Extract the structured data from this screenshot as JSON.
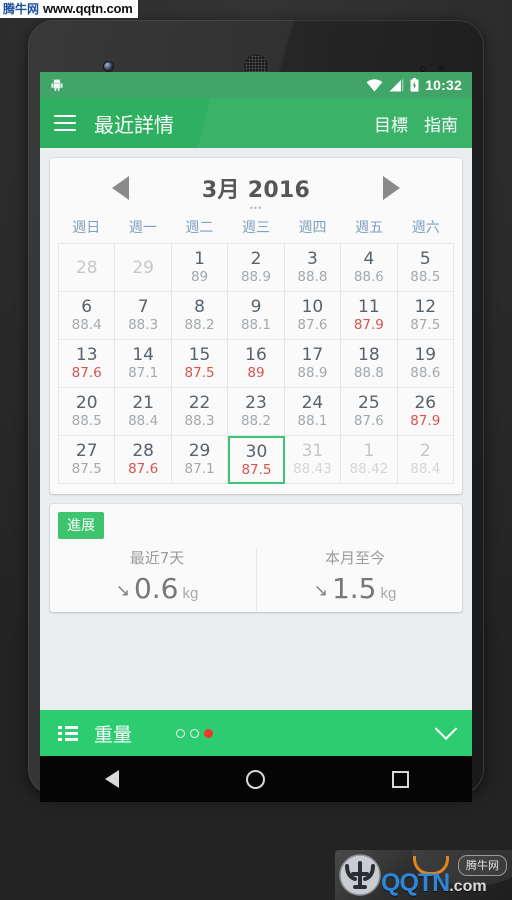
{
  "watermarks": {
    "top_left_cn": "腾牛网",
    "top_left_url": "www.qqtn.com",
    "bottom_right_brand": "QQTN",
    "bottom_right_tld": ".com",
    "bottom_right_badge": "腾牛网"
  },
  "statusbar": {
    "time": "10:32",
    "icons": [
      "android-robot-icon",
      "wifi-icon",
      "signal-icon",
      "battery-charging-icon"
    ]
  },
  "toolbar": {
    "menu_icon": "hamburger-menu-icon",
    "title": "最近詳情",
    "action_goal": "目標",
    "action_guide": "指南"
  },
  "calendar": {
    "prev_icon": "triangle-left-icon",
    "next_icon": "triangle-right-icon",
    "title": "3月 2016",
    "dots": "•••",
    "weekdays": [
      "週日",
      "週一",
      "週二",
      "週三",
      "週四",
      "週五",
      "週六"
    ],
    "rows": [
      [
        {
          "day": "28",
          "value": "",
          "muted": true,
          "red": false,
          "selected": false
        },
        {
          "day": "29",
          "value": "",
          "muted": true,
          "red": false,
          "selected": false
        },
        {
          "day": "1",
          "value": "89",
          "muted": false,
          "red": false,
          "selected": false
        },
        {
          "day": "2",
          "value": "88.9",
          "muted": false,
          "red": false,
          "selected": false
        },
        {
          "day": "3",
          "value": "88.8",
          "muted": false,
          "red": false,
          "selected": false
        },
        {
          "day": "4",
          "value": "88.6",
          "muted": false,
          "red": false,
          "selected": false
        },
        {
          "day": "5",
          "value": "88.5",
          "muted": false,
          "red": false,
          "selected": false
        }
      ],
      [
        {
          "day": "6",
          "value": "88.4",
          "muted": false,
          "red": false,
          "selected": false
        },
        {
          "day": "7",
          "value": "88.3",
          "muted": false,
          "red": false,
          "selected": false
        },
        {
          "day": "8",
          "value": "88.2",
          "muted": false,
          "red": false,
          "selected": false
        },
        {
          "day": "9",
          "value": "88.1",
          "muted": false,
          "red": false,
          "selected": false
        },
        {
          "day": "10",
          "value": "87.6",
          "muted": false,
          "red": false,
          "selected": false
        },
        {
          "day": "11",
          "value": "87.9",
          "muted": false,
          "red": true,
          "selected": false
        },
        {
          "day": "12",
          "value": "87.5",
          "muted": false,
          "red": false,
          "selected": false
        }
      ],
      [
        {
          "day": "13",
          "value": "87.6",
          "muted": false,
          "red": true,
          "selected": false
        },
        {
          "day": "14",
          "value": "87.1",
          "muted": false,
          "red": false,
          "selected": false
        },
        {
          "day": "15",
          "value": "87.5",
          "muted": false,
          "red": true,
          "selected": false
        },
        {
          "day": "16",
          "value": "89",
          "muted": false,
          "red": true,
          "selected": false
        },
        {
          "day": "17",
          "value": "88.9",
          "muted": false,
          "red": false,
          "selected": false
        },
        {
          "day": "18",
          "value": "88.8",
          "muted": false,
          "red": false,
          "selected": false
        },
        {
          "day": "19",
          "value": "88.6",
          "muted": false,
          "red": false,
          "selected": false
        }
      ],
      [
        {
          "day": "20",
          "value": "88.5",
          "muted": false,
          "red": false,
          "selected": false
        },
        {
          "day": "21",
          "value": "88.4",
          "muted": false,
          "red": false,
          "selected": false
        },
        {
          "day": "22",
          "value": "88.3",
          "muted": false,
          "red": false,
          "selected": false
        },
        {
          "day": "23",
          "value": "88.2",
          "muted": false,
          "red": false,
          "selected": false
        },
        {
          "day": "24",
          "value": "88.1",
          "muted": false,
          "red": false,
          "selected": false
        },
        {
          "day": "25",
          "value": "87.6",
          "muted": false,
          "red": false,
          "selected": false
        },
        {
          "day": "26",
          "value": "87.9",
          "muted": false,
          "red": true,
          "selected": false
        }
      ],
      [
        {
          "day": "27",
          "value": "87.5",
          "muted": false,
          "red": false,
          "selected": false
        },
        {
          "day": "28",
          "value": "87.6",
          "muted": false,
          "red": true,
          "selected": false
        },
        {
          "day": "29",
          "value": "87.1",
          "muted": false,
          "red": false,
          "selected": false
        },
        {
          "day": "30",
          "value": "87.5",
          "muted": false,
          "red": true,
          "selected": true
        },
        {
          "day": "31",
          "value": "88.43",
          "muted": true,
          "red": false,
          "selected": false
        },
        {
          "day": "1",
          "value": "88.42",
          "muted": true,
          "red": false,
          "selected": false
        },
        {
          "day": "2",
          "value": "88.4",
          "muted": true,
          "red": false,
          "selected": false
        }
      ]
    ],
    "selected_border_color": "#3fc27a",
    "red_color": "#d9534f"
  },
  "progress": {
    "badge": "進展",
    "stats": [
      {
        "label": "最近7天",
        "trend_icon": "arrow-down-right-icon",
        "value": "0.6",
        "unit": "kg"
      },
      {
        "label": "本月至今",
        "trend_icon": "arrow-down-right-icon",
        "value": "1.5",
        "unit": "kg"
      }
    ]
  },
  "bottombar": {
    "list_icon": "list-view-icon",
    "title": "重量",
    "page_dots": [
      false,
      false,
      true
    ],
    "expand_icon": "chevron-down-icon",
    "color": "#2ecc71"
  },
  "navbar": {
    "back": "nav-back-icon",
    "home": "nav-home-icon",
    "recents": "nav-recents-icon"
  }
}
